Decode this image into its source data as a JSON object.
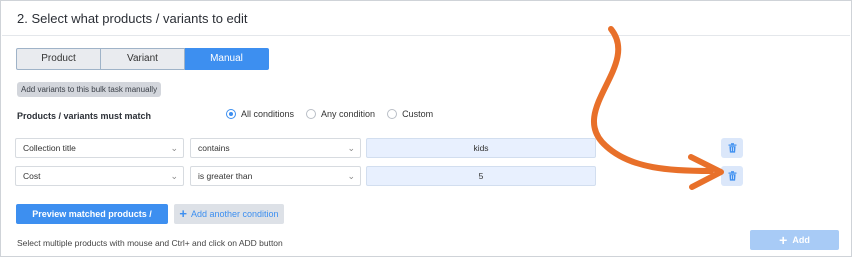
{
  "section": {
    "title": "2. Select what products / variants to edit"
  },
  "tabs": [
    {
      "label": "Product",
      "active": false
    },
    {
      "label": "Variant",
      "active": false
    },
    {
      "label": "Manual",
      "active": true
    }
  ],
  "hint_badge": "Add variants to this bulk task manually",
  "match": {
    "label": "Products / variants must match",
    "options": [
      {
        "label": "All conditions",
        "selected": true
      },
      {
        "label": "Any condition",
        "selected": false
      },
      {
        "label": "Custom",
        "selected": false
      }
    ]
  },
  "conditions": [
    {
      "field": "Collection title",
      "operator": "contains",
      "value": "kids"
    },
    {
      "field": "Cost",
      "operator": "is greater than",
      "value": "5"
    }
  ],
  "buttons": {
    "preview": "Preview matched products / variants",
    "add_condition": "Add another condition",
    "add": "Add"
  },
  "help_text": "Select multiple products with mouse and Ctrl+ and click on ADD button",
  "icons": {
    "trash": "trash-icon",
    "chevron": "chevron-down-icon",
    "plus": "plus-icon",
    "annotation_arrow": "curved-arrow-annotation"
  },
  "colors": {
    "accent": "#3d8ff0",
    "add_disabled": "#a8cbf6",
    "annotation_arrow": "#e8702a",
    "value_bg": "#e8f0fe"
  }
}
